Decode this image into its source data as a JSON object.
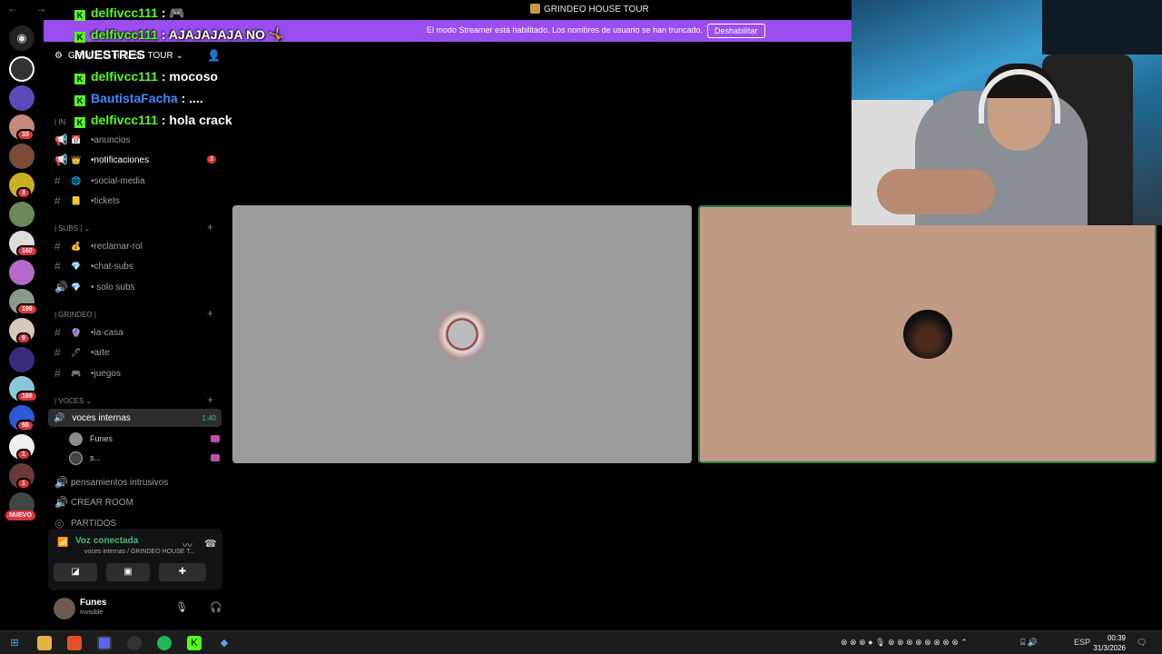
{
  "window": {
    "title": "GRINDEO HOUSE TOUR",
    "nav": "← →"
  },
  "banner": {
    "text": "El modo Streamer está habilitado. Los nombres de usuario se han truncado.",
    "button": "Deshabilitar",
    "color": "#9b4df0"
  },
  "server": {
    "name": "GRINDEO HOUSE TOUR ⌄"
  },
  "rail": {
    "badges": [
      "33",
      "3",
      "160",
      "199",
      "9",
      "186",
      "55",
      "1",
      "1"
    ],
    "new_label": "NUEVO"
  },
  "categories": [
    {
      "label": "| IN"
    },
    {
      "label": "| SUBS | ⌄"
    },
    {
      "label": "| GRINDEO |"
    },
    {
      "label": "| VOCES ⌄"
    }
  ],
  "channels": [
    {
      "name": "•anuncios",
      "emoji": "📅"
    },
    {
      "name": "•notificaciones",
      "emoji": "👑",
      "badge": "3"
    },
    {
      "name": "•social-media",
      "emoji": "🌐"
    },
    {
      "name": "•tickets",
      "emoji": "📒"
    },
    {
      "name": "•reclamar-rol",
      "emoji": "💰"
    },
    {
      "name": "•chat-subs",
      "emoji": "💎"
    },
    {
      "name": "• solo subs",
      "emoji": "💎"
    },
    {
      "name": "•la-casa",
      "emoji": "🔮"
    },
    {
      "name": "•arte",
      "emoji": "🖊"
    },
    {
      "name": "•juegos",
      "emoji": "🎮"
    }
  ],
  "voice": {
    "active_channel": "voces internas",
    "duration": "1:40",
    "members": [
      "Funes",
      "s..."
    ],
    "other_channels": [
      "pensamientos intrusivos",
      "CREAR ROOM",
      "PARTIDOS"
    ]
  },
  "voice_panel": {
    "title": "Voz conectada",
    "subtitle": "voces internas / GRINDEO HOUSE T..."
  },
  "user": {
    "name": "Funes",
    "status": "Invisible"
  },
  "chat": [
    {
      "user": "delfivcc111",
      "message": ": 🎮"
    },
    {
      "user": "delfivcc111",
      "message": ": AJAJAJAJA NO 🤸"
    },
    {
      "user": "",
      "message": "MUESTRES"
    },
    {
      "user": "delfivcc111",
      "message": ": mocoso"
    },
    {
      "user": "BautistaFacha",
      "message": ": ...."
    },
    {
      "user": "delfivcc111",
      "message": ": hola crack"
    }
  ],
  "tiles": {
    "left_color": "#9b9b9b",
    "right_color": "#c09a84"
  },
  "taskbar": {
    "lang": "ESP",
    "time": "00:39",
    "date": "31/3/2026"
  }
}
